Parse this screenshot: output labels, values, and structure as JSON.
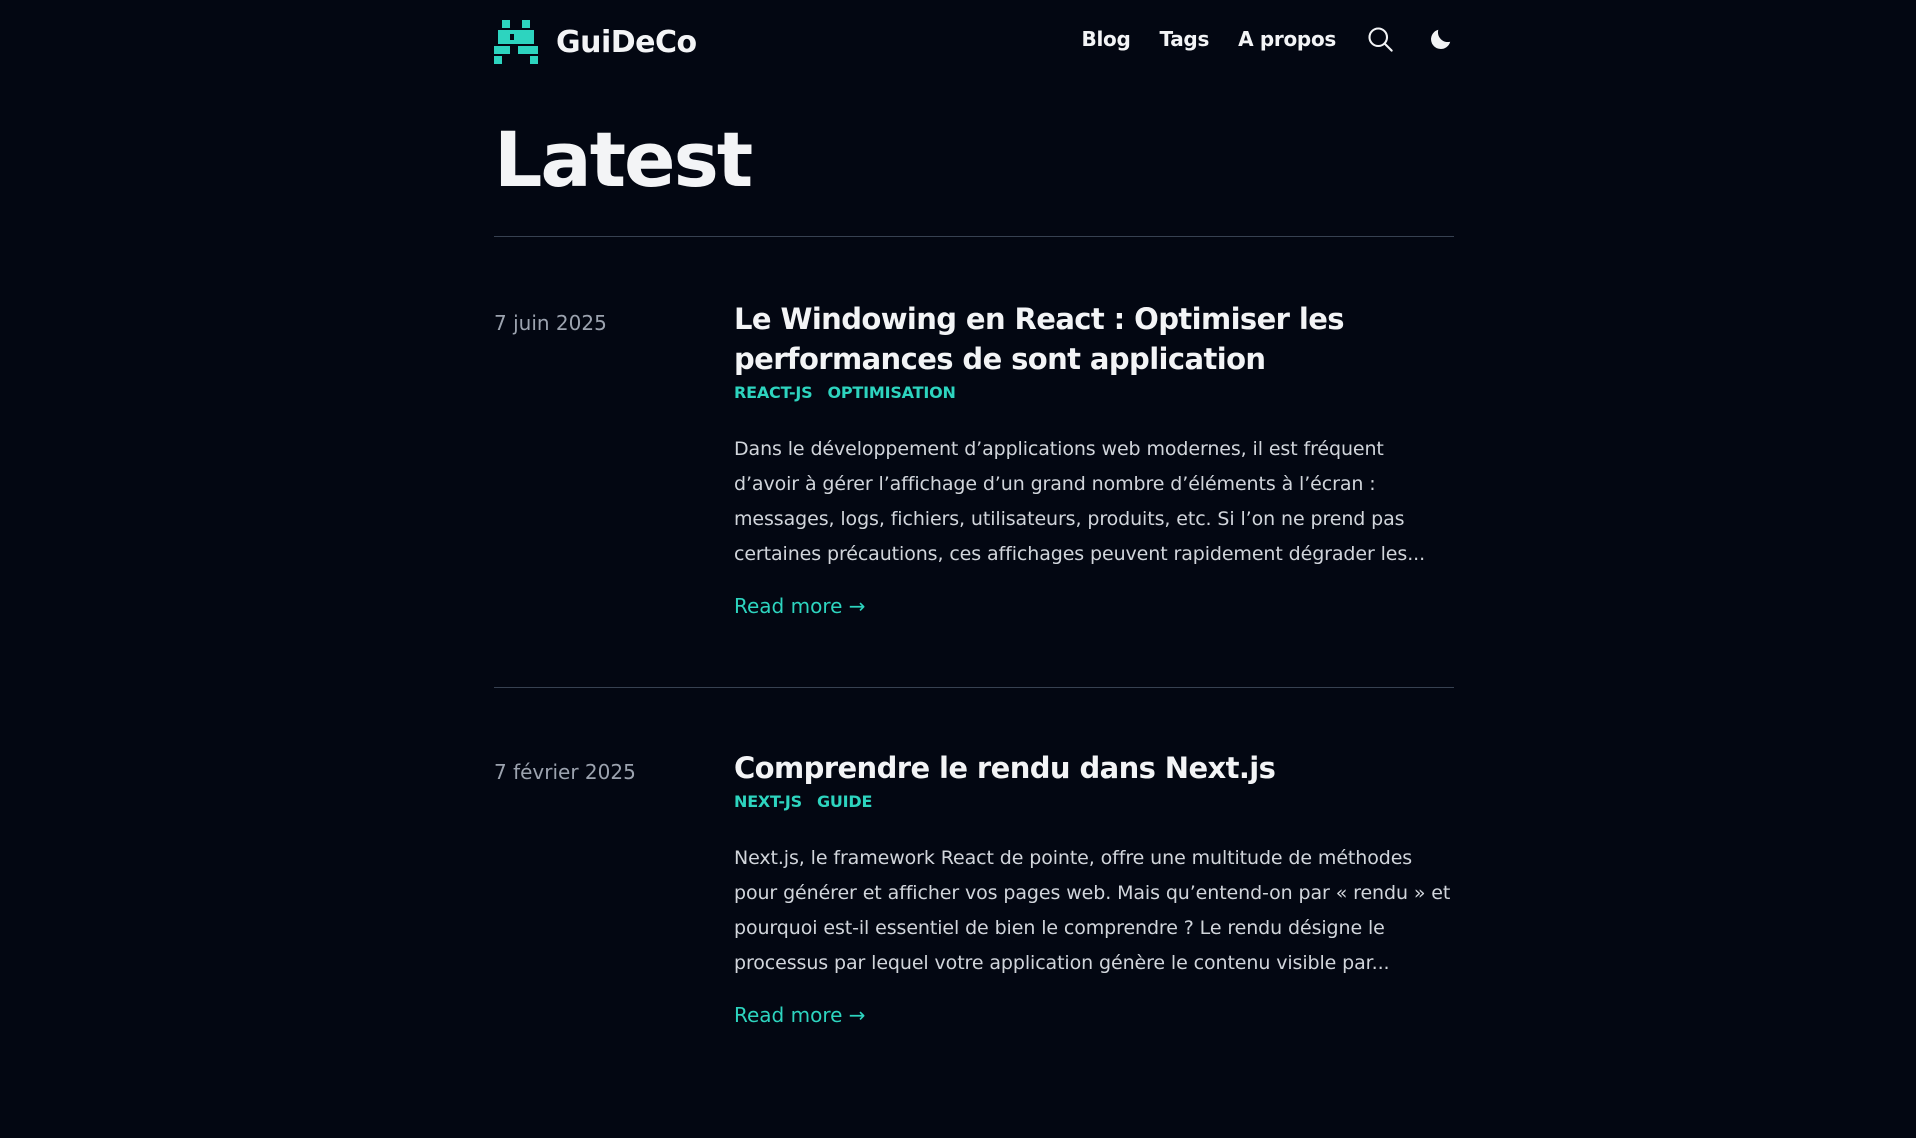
{
  "header": {
    "site_title": "GuiDeCo",
    "logo_icon": "pixel-logo-icon",
    "nav": [
      {
        "label": "Blog"
      },
      {
        "label": "Tags"
      },
      {
        "label": "A propos"
      }
    ],
    "search_icon": "search-icon",
    "theme_icon": "moon-icon"
  },
  "page": {
    "title": "Latest"
  },
  "posts": [
    {
      "date": "7 juin 2025",
      "title": "Le Windowing en React : Optimiser les performances de sont application",
      "tags": [
        "react-js",
        "optimisation"
      ],
      "excerpt": "Dans le développement d’applications web modernes, il est fréquent d’avoir à gérer l’affichage d’un grand nombre d’éléments à l’écran : messages, logs, fichiers, utilisateurs, produits, etc. Si l’on ne prend pas certaines précautions, ces affichages peuvent rapidement dégrader les...",
      "read_more": "Read more →"
    },
    {
      "date": "7 février 2025",
      "title": "Comprendre le rendu dans Next.js",
      "tags": [
        "next-js",
        "guide"
      ],
      "excerpt": "Next.js, le framework React de pointe, offre une multitude de méthodes pour générer et afficher vos pages web. Mais qu’entend-on par « rendu » et pourquoi est-il essentiel de bien le comprendre ? Le rendu désigne le processus par lequel votre application génère le contenu visible par...",
      "read_more": "Read more →"
    }
  ],
  "colors": {
    "background": "#030712",
    "accent": "#2dd4bf",
    "text": "#f3f4f6",
    "muted": "#9ca3af",
    "divider": "#374151"
  }
}
